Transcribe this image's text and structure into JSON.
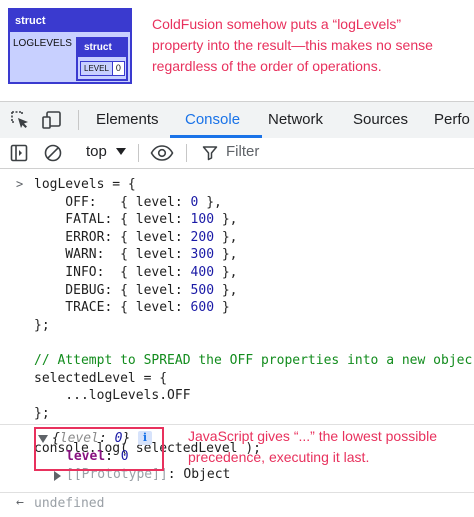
{
  "cfdump": {
    "header": "struct",
    "key": "LOGLEVELS",
    "inner_header": "struct",
    "inner_key": "LEVEL",
    "inner_value": "0"
  },
  "annotations": {
    "top_note": "ColdFusion somehow puts a “logLevels” property into the result—this makes no sense regardless of the order of operations.",
    "bottom_note": "JavaScript gives “...” the lowest possible precedence, executing it last."
  },
  "devtools": {
    "tabs": [
      {
        "label": "Elements",
        "active": false
      },
      {
        "label": "Console",
        "active": true
      },
      {
        "label": "Network",
        "active": false
      },
      {
        "label": "Sources",
        "active": false
      },
      {
        "label": "Perfo",
        "active": false
      }
    ],
    "context": "top",
    "filter_placeholder": "Filter",
    "accent": "#1a73e8"
  },
  "console": {
    "prompt": ">",
    "lines": [
      [
        "logLevels = {"
      ],
      [
        "    OFF:   { level: ",
        "0",
        " },"
      ],
      [
        "    FATAL: { level: ",
        "100",
        " },"
      ],
      [
        "    ERROR: { level: ",
        "200",
        " },"
      ],
      [
        "    WARN:  { level: ",
        "300",
        " },"
      ],
      [
        "    INFO:  { level: ",
        "400",
        " },"
      ],
      [
        "    DEBUG: { level: ",
        "500",
        " },"
      ],
      [
        "    TRACE: { level: ",
        "600",
        " }"
      ],
      [
        "};"
      ],
      [
        ""
      ],
      [
        "// Attempt to SPREAD the OFF properties into a new objec"
      ],
      [
        "selectedLevel = {"
      ],
      [
        "    ...logLevels.OFF"
      ],
      [
        "};"
      ],
      [
        ""
      ],
      [
        "console.log( selectedLevel );"
      ]
    ],
    "output": {
      "preview_open": "{",
      "preview_key": "level",
      "preview_sep": ": ",
      "preview_value": "0",
      "preview_close": "}",
      "info_badge": "i",
      "prop_key": "level",
      "prop_sep": ": ",
      "prop_value": "0",
      "proto_key": "[[Prototype]]",
      "proto_value": ": Object"
    },
    "return_arrow": "←",
    "return_value": "undefined"
  }
}
